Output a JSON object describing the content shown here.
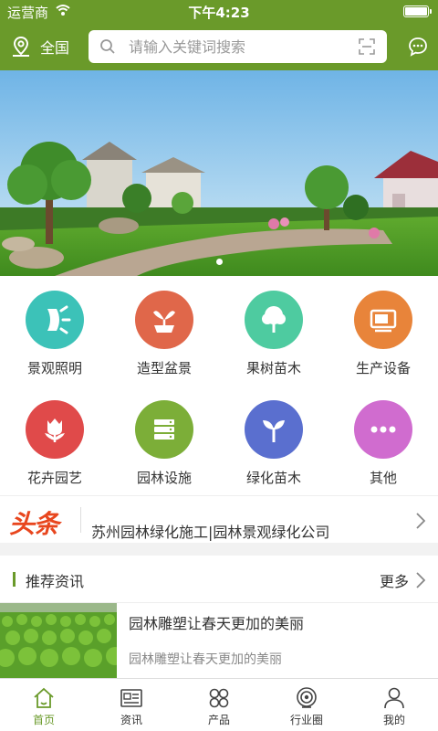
{
  "status_bar": {
    "carrier": "运营商",
    "time": "下午4:23"
  },
  "header": {
    "region_label": "全国",
    "search_placeholder": "请输入关键词搜索"
  },
  "banner": {
    "slide_count": 1,
    "active_index": 0
  },
  "categories": [
    {
      "label": "景观照明",
      "color": "#3cc2b8",
      "icon": "lamp-icon"
    },
    {
      "label": "造型盆景",
      "color": "#e0674a",
      "icon": "bonsai-icon"
    },
    {
      "label": "果树苗木",
      "color": "#4ecba0",
      "icon": "tree-icon"
    },
    {
      "label": "生产设备",
      "color": "#e8843a",
      "icon": "machine-icon"
    },
    {
      "label": "花卉园艺",
      "color": "#e04a4a",
      "icon": "tulip-icon"
    },
    {
      "label": "园林设施",
      "color": "#7cae38",
      "icon": "facility-icon"
    },
    {
      "label": "绿化苗木",
      "color": "#5a6fcf",
      "icon": "sprout-icon"
    },
    {
      "label": "其他",
      "color": "#d06ccf",
      "icon": "more-dots-icon"
    }
  ],
  "headline": {
    "tag": "头条",
    "text": "苏州园林绿化施工|园林景观绿化公司"
  },
  "recommend": {
    "title": "推荐资讯",
    "more": "更多",
    "articles": [
      {
        "title": "园林雕塑让春天更加的美丽",
        "desc": "园林雕塑让春天更加的美丽"
      }
    ]
  },
  "tabs": [
    {
      "label": "首页",
      "icon": "home-icon",
      "active": true
    },
    {
      "label": "资讯",
      "icon": "news-icon",
      "active": false
    },
    {
      "label": "产品",
      "icon": "grid-icon",
      "active": false
    },
    {
      "label": "行业圈",
      "icon": "circle-icon",
      "active": false
    },
    {
      "label": "我的",
      "icon": "user-icon",
      "active": false
    }
  ],
  "colors": {
    "brand": "#6a9a2a",
    "headline_red": "#e8461e"
  }
}
